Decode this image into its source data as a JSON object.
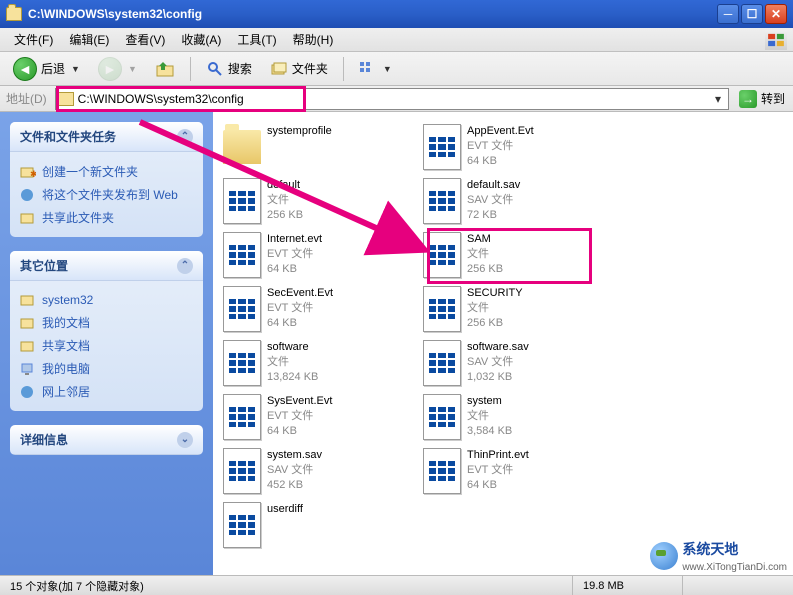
{
  "window": {
    "title": "C:\\WINDOWS\\system32\\config"
  },
  "menu": {
    "file": "文件(F)",
    "edit": "编辑(E)",
    "view": "查看(V)",
    "favorites": "收藏(A)",
    "tools": "工具(T)",
    "help": "帮助(H)"
  },
  "toolbar": {
    "back": "后退",
    "search": "搜索",
    "folders": "文件夹"
  },
  "addressbar": {
    "label": "地址(D)",
    "path": "C:\\WINDOWS\\system32\\config",
    "go": "转到"
  },
  "sidebar": {
    "tasks": {
      "title": "文件和文件夹任务",
      "items": [
        "创建一个新文件夹",
        "将这个文件夹发布到 Web",
        "共享此文件夹"
      ]
    },
    "places": {
      "title": "其它位置",
      "items": [
        "system32",
        "我的文档",
        "共享文档",
        "我的电脑",
        "网上邻居"
      ]
    },
    "details": {
      "title": "详细信息"
    }
  },
  "files": {
    "col1": [
      {
        "name": "systemprofile",
        "type": "",
        "size": "",
        "kind": "folder"
      },
      {
        "name": "default",
        "type": "文件",
        "size": "256 KB",
        "kind": "file"
      },
      {
        "name": "Internet.evt",
        "type": "EVT 文件",
        "size": "64 KB",
        "kind": "file"
      },
      {
        "name": "SecEvent.Evt",
        "type": "EVT 文件",
        "size": "64 KB",
        "kind": "file"
      },
      {
        "name": "software",
        "type": "文件",
        "size": "13,824 KB",
        "kind": "file"
      },
      {
        "name": "SysEvent.Evt",
        "type": "EVT 文件",
        "size": "64 KB",
        "kind": "file"
      },
      {
        "name": "system.sav",
        "type": "SAV 文件",
        "size": "452 KB",
        "kind": "file"
      },
      {
        "name": "userdiff",
        "type": "",
        "size": "",
        "kind": "file"
      }
    ],
    "col2": [
      {
        "name": "AppEvent.Evt",
        "type": "EVT 文件",
        "size": "64 KB",
        "kind": "file"
      },
      {
        "name": "default.sav",
        "type": "SAV 文件",
        "size": "72 KB",
        "kind": "file"
      },
      {
        "name": "SAM",
        "type": "文件",
        "size": "256 KB",
        "kind": "file"
      },
      {
        "name": "SECURITY",
        "type": "文件",
        "size": "256 KB",
        "kind": "file"
      },
      {
        "name": "software.sav",
        "type": "SAV 文件",
        "size": "1,032 KB",
        "kind": "file"
      },
      {
        "name": "system",
        "type": "文件",
        "size": "3,584 KB",
        "kind": "file"
      },
      {
        "name": "ThinPrint.evt",
        "type": "EVT 文件",
        "size": "64 KB",
        "kind": "file"
      }
    ]
  },
  "statusbar": {
    "objects": "15 个对象(加 7 个隐藏对象)",
    "size": "19.8 MB"
  },
  "watermark": {
    "brand": "系统天地",
    "url": "www.XiTongTianDi.com"
  }
}
